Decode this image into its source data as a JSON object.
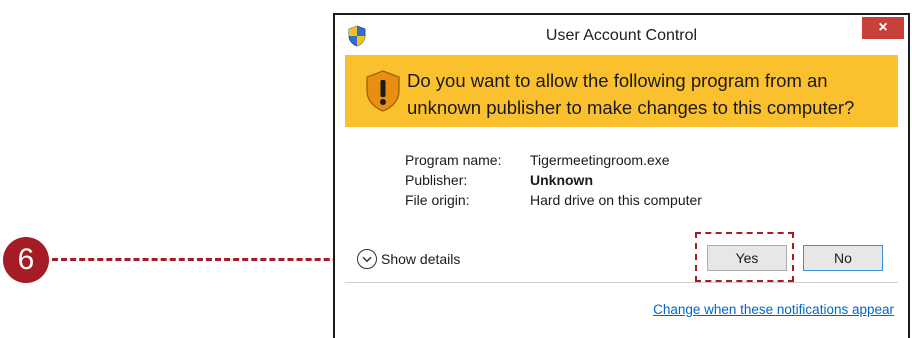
{
  "annotation": {
    "step_number": "6",
    "color": "#a51c24"
  },
  "dialog": {
    "title": "User Account Control",
    "close_glyph": "×",
    "warning": {
      "text": "Do you want to allow the following program from an unknown publisher to make changes to this computer?",
      "background": "#fbc02e"
    },
    "info": [
      {
        "label": "Program name:",
        "value": "Tigermeetingroom.exe",
        "bold": false
      },
      {
        "label": "Publisher:",
        "value": "Unknown",
        "bold": true
      },
      {
        "label": "File origin:",
        "value": "Hard drive on this computer",
        "bold": false
      }
    ],
    "show_details_label": "Show details",
    "yes_label": "Yes",
    "no_label": "No",
    "change_link": "Change when these notifications appear"
  }
}
